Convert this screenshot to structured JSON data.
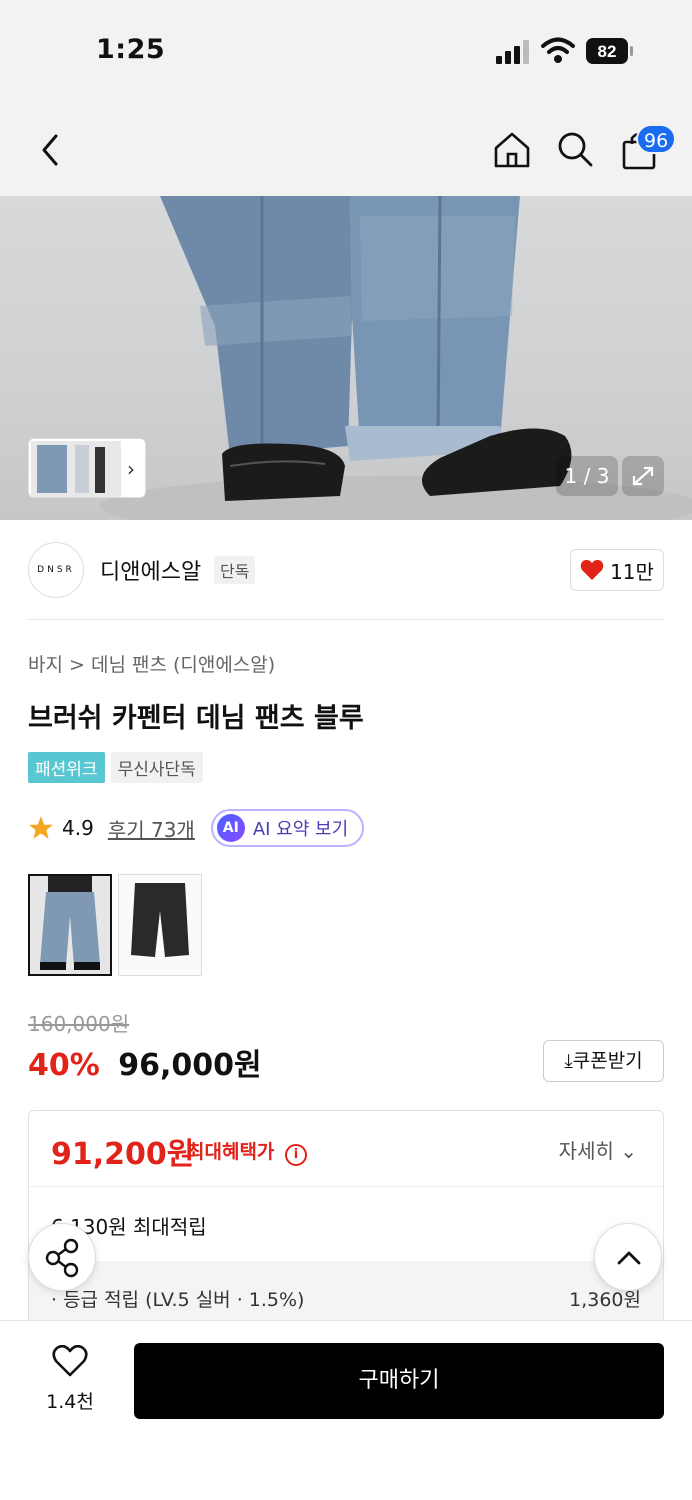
{
  "status_bar": {
    "time": "1:25",
    "battery": "82"
  },
  "nav": {
    "cart_count": "96"
  },
  "gallery": {
    "counter": "1 / 3"
  },
  "brand": {
    "logo_text": "DNSR",
    "name": "디앤에스알",
    "tag": "단독",
    "likes": "11만"
  },
  "breadcrumb": "바지 > 데님 팬츠 (디앤에스알)",
  "product": {
    "title": "브러쉬 카펜터 데님 팬츠 블루",
    "tags": [
      "패션위크",
      "무신사단독"
    ],
    "rating": "4.9",
    "reviews": "후기 73개",
    "ai_label": "AI 요약 보기",
    "ai_badge": "AI"
  },
  "price": {
    "original": "160,000원",
    "discount": "40%",
    "current": "96,000원",
    "coupon_label": "쿠폰받기"
  },
  "benefit": {
    "max_price": "91,200원",
    "max_label": "최대혜택가",
    "info_icon": "i",
    "detail_label": "자세히",
    "points_title": "6,130원 최대적립",
    "tier_label": "· 등급 적립 (LV.5 실버 · 1.5%)",
    "tier_value": "1,360원"
  },
  "bottom": {
    "wish_count": "1.4천",
    "buy_label": "구매하기"
  },
  "colors": {
    "accent_red": "#e2231a",
    "badge_blue": "#1a6cf0",
    "tag_cyan": "#59c7d2"
  }
}
